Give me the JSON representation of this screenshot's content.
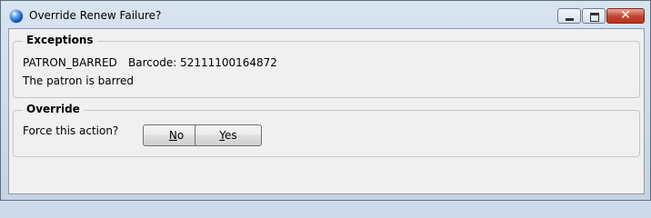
{
  "window": {
    "title": "Override Renew Failure?",
    "controls": [
      "minimize-icon",
      "maximize-icon",
      "close-icon"
    ]
  },
  "exceptions": {
    "legend": "Exceptions",
    "code": "PATRON_BARRED",
    "barcode_label": "Barcode: 52111100164872",
    "message": "The patron is barred"
  },
  "override": {
    "legend": "Override",
    "prompt": "Force this action?",
    "no_mnemonic": "N",
    "no_rest": "o",
    "yes_mnemonic": "Y",
    "yes_rest": "es"
  },
  "colors": {
    "close_button": "#c4412c",
    "client_background": "#f0f0f0"
  }
}
